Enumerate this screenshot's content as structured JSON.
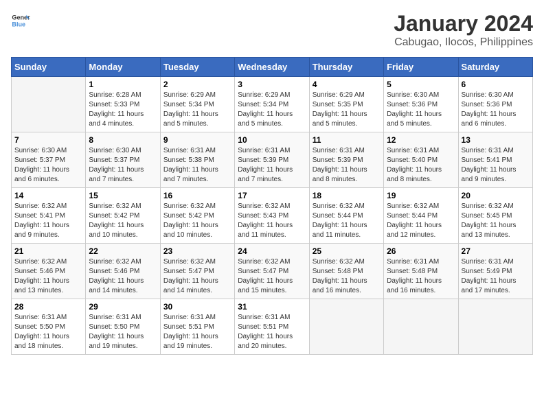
{
  "header": {
    "logo_general": "General",
    "logo_blue": "Blue",
    "title": "January 2024",
    "subtitle": "Cabugao, Ilocos, Philippines"
  },
  "weekdays": [
    "Sunday",
    "Monday",
    "Tuesday",
    "Wednesday",
    "Thursday",
    "Friday",
    "Saturday"
  ],
  "weeks": [
    [
      {
        "date": "",
        "info": ""
      },
      {
        "date": "1",
        "info": "Sunrise: 6:28 AM\nSunset: 5:33 PM\nDaylight: 11 hours\nand 4 minutes."
      },
      {
        "date": "2",
        "info": "Sunrise: 6:29 AM\nSunset: 5:34 PM\nDaylight: 11 hours\nand 5 minutes."
      },
      {
        "date": "3",
        "info": "Sunrise: 6:29 AM\nSunset: 5:34 PM\nDaylight: 11 hours\nand 5 minutes."
      },
      {
        "date": "4",
        "info": "Sunrise: 6:29 AM\nSunset: 5:35 PM\nDaylight: 11 hours\nand 5 minutes."
      },
      {
        "date": "5",
        "info": "Sunrise: 6:30 AM\nSunset: 5:36 PM\nDaylight: 11 hours\nand 5 minutes."
      },
      {
        "date": "6",
        "info": "Sunrise: 6:30 AM\nSunset: 5:36 PM\nDaylight: 11 hours\nand 6 minutes."
      }
    ],
    [
      {
        "date": "7",
        "info": "Sunrise: 6:30 AM\nSunset: 5:37 PM\nDaylight: 11 hours\nand 6 minutes."
      },
      {
        "date": "8",
        "info": "Sunrise: 6:30 AM\nSunset: 5:37 PM\nDaylight: 11 hours\nand 7 minutes."
      },
      {
        "date": "9",
        "info": "Sunrise: 6:31 AM\nSunset: 5:38 PM\nDaylight: 11 hours\nand 7 minutes."
      },
      {
        "date": "10",
        "info": "Sunrise: 6:31 AM\nSunset: 5:39 PM\nDaylight: 11 hours\nand 7 minutes."
      },
      {
        "date": "11",
        "info": "Sunrise: 6:31 AM\nSunset: 5:39 PM\nDaylight: 11 hours\nand 8 minutes."
      },
      {
        "date": "12",
        "info": "Sunrise: 6:31 AM\nSunset: 5:40 PM\nDaylight: 11 hours\nand 8 minutes."
      },
      {
        "date": "13",
        "info": "Sunrise: 6:31 AM\nSunset: 5:41 PM\nDaylight: 11 hours\nand 9 minutes."
      }
    ],
    [
      {
        "date": "14",
        "info": "Sunrise: 6:32 AM\nSunset: 5:41 PM\nDaylight: 11 hours\nand 9 minutes."
      },
      {
        "date": "15",
        "info": "Sunrise: 6:32 AM\nSunset: 5:42 PM\nDaylight: 11 hours\nand 10 minutes."
      },
      {
        "date": "16",
        "info": "Sunrise: 6:32 AM\nSunset: 5:42 PM\nDaylight: 11 hours\nand 10 minutes."
      },
      {
        "date": "17",
        "info": "Sunrise: 6:32 AM\nSunset: 5:43 PM\nDaylight: 11 hours\nand 11 minutes."
      },
      {
        "date": "18",
        "info": "Sunrise: 6:32 AM\nSunset: 5:44 PM\nDaylight: 11 hours\nand 11 minutes."
      },
      {
        "date": "19",
        "info": "Sunrise: 6:32 AM\nSunset: 5:44 PM\nDaylight: 11 hours\nand 12 minutes."
      },
      {
        "date": "20",
        "info": "Sunrise: 6:32 AM\nSunset: 5:45 PM\nDaylight: 11 hours\nand 13 minutes."
      }
    ],
    [
      {
        "date": "21",
        "info": "Sunrise: 6:32 AM\nSunset: 5:46 PM\nDaylight: 11 hours\nand 13 minutes."
      },
      {
        "date": "22",
        "info": "Sunrise: 6:32 AM\nSunset: 5:46 PM\nDaylight: 11 hours\nand 14 minutes."
      },
      {
        "date": "23",
        "info": "Sunrise: 6:32 AM\nSunset: 5:47 PM\nDaylight: 11 hours\nand 14 minutes."
      },
      {
        "date": "24",
        "info": "Sunrise: 6:32 AM\nSunset: 5:47 PM\nDaylight: 11 hours\nand 15 minutes."
      },
      {
        "date": "25",
        "info": "Sunrise: 6:32 AM\nSunset: 5:48 PM\nDaylight: 11 hours\nand 16 minutes."
      },
      {
        "date": "26",
        "info": "Sunrise: 6:31 AM\nSunset: 5:48 PM\nDaylight: 11 hours\nand 16 minutes."
      },
      {
        "date": "27",
        "info": "Sunrise: 6:31 AM\nSunset: 5:49 PM\nDaylight: 11 hours\nand 17 minutes."
      }
    ],
    [
      {
        "date": "28",
        "info": "Sunrise: 6:31 AM\nSunset: 5:50 PM\nDaylight: 11 hours\nand 18 minutes."
      },
      {
        "date": "29",
        "info": "Sunrise: 6:31 AM\nSunset: 5:50 PM\nDaylight: 11 hours\nand 19 minutes."
      },
      {
        "date": "30",
        "info": "Sunrise: 6:31 AM\nSunset: 5:51 PM\nDaylight: 11 hours\nand 19 minutes."
      },
      {
        "date": "31",
        "info": "Sunrise: 6:31 AM\nSunset: 5:51 PM\nDaylight: 11 hours\nand 20 minutes."
      },
      {
        "date": "",
        "info": ""
      },
      {
        "date": "",
        "info": ""
      },
      {
        "date": "",
        "info": ""
      }
    ]
  ]
}
